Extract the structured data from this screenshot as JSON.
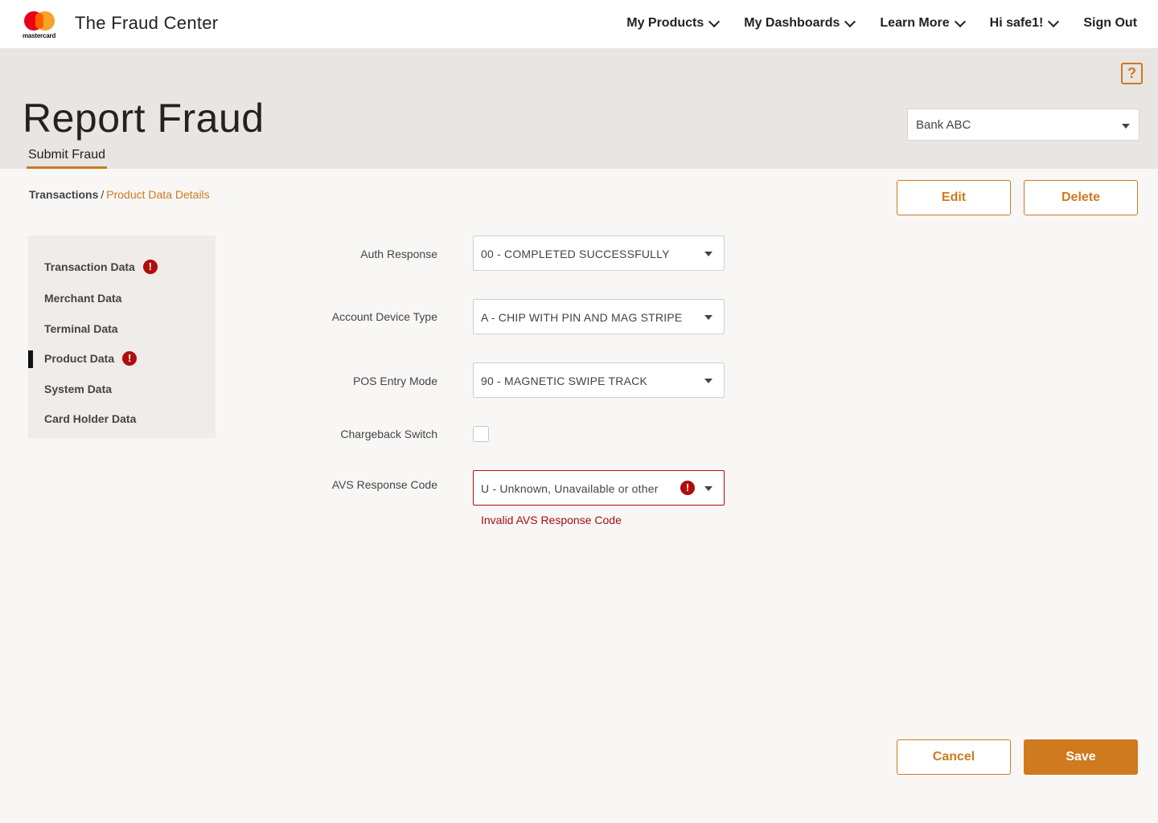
{
  "brand": {
    "logo_word": "mastercard",
    "app_title": "The Fraud Center"
  },
  "nav": {
    "items": [
      {
        "label": "My Products",
        "dropdown": true
      },
      {
        "label": "My Dashboards",
        "dropdown": true
      },
      {
        "label": "Learn More",
        "dropdown": true
      },
      {
        "label": "Hi safe1!",
        "dropdown": true
      },
      {
        "label": "Sign Out",
        "dropdown": false
      }
    ]
  },
  "header": {
    "help_icon": "?",
    "title": "Report Fraud",
    "active_tab": "Submit Fraud",
    "bank_select": "Bank ABC"
  },
  "breadcrumb": {
    "parent": "Transactions",
    "separator": "/",
    "current": "Product Data Details"
  },
  "actions": {
    "edit": "Edit",
    "delete": "Delete",
    "cancel": "Cancel",
    "save": "Save"
  },
  "sidebar": {
    "items": [
      {
        "label": "Transaction Data",
        "error": true
      },
      {
        "label": "Merchant Data",
        "error": false
      },
      {
        "label": "Terminal Data",
        "error": false
      },
      {
        "label": "Product Data",
        "error": true,
        "active": true
      },
      {
        "label": "System Data",
        "error": false
      },
      {
        "label": "Card Holder Data",
        "error": false
      }
    ],
    "error_glyph": "!"
  },
  "form": {
    "auth_response": {
      "label": "Auth Response",
      "value": "00 - COMPLETED SUCCESSFULLY"
    },
    "account_device_type": {
      "label": "Account Device Type",
      "value": "A - CHIP WITH PIN AND MAG STRIPE"
    },
    "pos_entry_mode": {
      "label": "POS Entry Mode",
      "value": "90 - MAGNETIC SWIPE TRACK"
    },
    "chargeback_switch": {
      "label": "Chargeback Switch",
      "checked": false
    },
    "avs_response_code": {
      "label": "AVS Response Code",
      "value": "U - Unknown, Unavailable or other",
      "error": "Invalid AVS Response Code"
    }
  },
  "colors": {
    "accent": "#cf7a1e",
    "error": "#b00d0d",
    "header_bg": "#e8e5e3"
  }
}
